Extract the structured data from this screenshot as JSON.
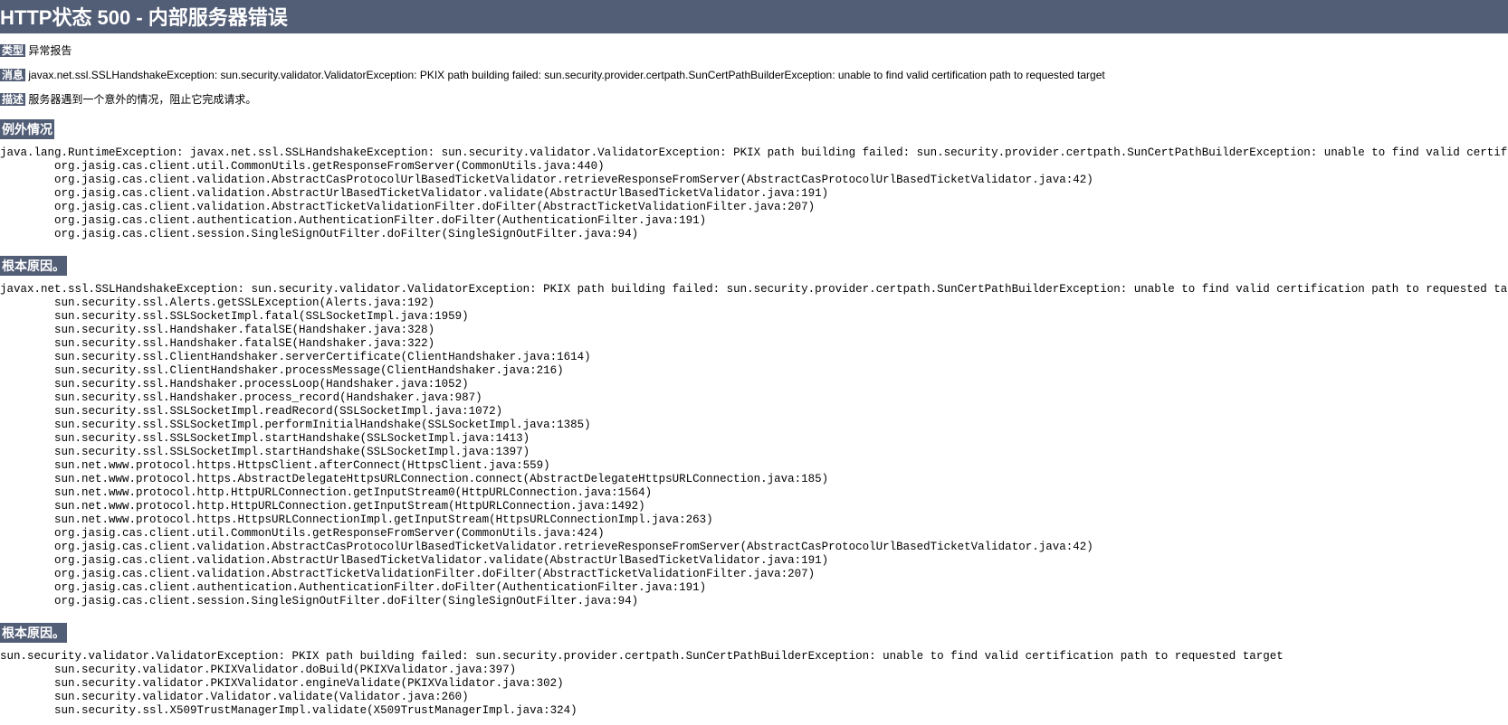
{
  "header": {
    "title": "HTTP状态 500 - 内部服务器错误"
  },
  "labels": {
    "type": "类型",
    "message": "消息",
    "description": "描述",
    "exception": "例外情况",
    "rootCause": "根本原因。"
  },
  "values": {
    "type": "异常报告",
    "message": "javax.net.ssl.SSLHandshakeException: sun.security.validator.ValidatorException: PKIX path building failed: sun.security.provider.certpath.SunCertPathBuilderException: unable to find valid certification path to requested target",
    "description": "服务器遇到一个意外的情况，阻止它完成请求。"
  },
  "stacks": {
    "exception": "java.lang.RuntimeException: javax.net.ssl.SSLHandshakeException: sun.security.validator.ValidatorException: PKIX path building failed: sun.security.provider.certpath.SunCertPathBuilderException: unable to find valid certification path to r\n\torg.jasig.cas.client.util.CommonUtils.getResponseFromServer(CommonUtils.java:440)\n\torg.jasig.cas.client.validation.AbstractCasProtocolUrlBasedTicketValidator.retrieveResponseFromServer(AbstractCasProtocolUrlBasedTicketValidator.java:42)\n\torg.jasig.cas.client.validation.AbstractUrlBasedTicketValidator.validate(AbstractUrlBasedTicketValidator.java:191)\n\torg.jasig.cas.client.validation.AbstractTicketValidationFilter.doFilter(AbstractTicketValidationFilter.java:207)\n\torg.jasig.cas.client.authentication.AuthenticationFilter.doFilter(AuthenticationFilter.java:191)\n\torg.jasig.cas.client.session.SingleSignOutFilter.doFilter(SingleSignOutFilter.java:94)",
    "rootCause1": "javax.net.ssl.SSLHandshakeException: sun.security.validator.ValidatorException: PKIX path building failed: sun.security.provider.certpath.SunCertPathBuilderException: unable to find valid certification path to requested target\n\tsun.security.ssl.Alerts.getSSLException(Alerts.java:192)\n\tsun.security.ssl.SSLSocketImpl.fatal(SSLSocketImpl.java:1959)\n\tsun.security.ssl.Handshaker.fatalSE(Handshaker.java:328)\n\tsun.security.ssl.Handshaker.fatalSE(Handshaker.java:322)\n\tsun.security.ssl.ClientHandshaker.serverCertificate(ClientHandshaker.java:1614)\n\tsun.security.ssl.ClientHandshaker.processMessage(ClientHandshaker.java:216)\n\tsun.security.ssl.Handshaker.processLoop(Handshaker.java:1052)\n\tsun.security.ssl.Handshaker.process_record(Handshaker.java:987)\n\tsun.security.ssl.SSLSocketImpl.readRecord(SSLSocketImpl.java:1072)\n\tsun.security.ssl.SSLSocketImpl.performInitialHandshake(SSLSocketImpl.java:1385)\n\tsun.security.ssl.SSLSocketImpl.startHandshake(SSLSocketImpl.java:1413)\n\tsun.security.ssl.SSLSocketImpl.startHandshake(SSLSocketImpl.java:1397)\n\tsun.net.www.protocol.https.HttpsClient.afterConnect(HttpsClient.java:559)\n\tsun.net.www.protocol.https.AbstractDelegateHttpsURLConnection.connect(AbstractDelegateHttpsURLConnection.java:185)\n\tsun.net.www.protocol.http.HttpURLConnection.getInputStream0(HttpURLConnection.java:1564)\n\tsun.net.www.protocol.http.HttpURLConnection.getInputStream(HttpURLConnection.java:1492)\n\tsun.net.www.protocol.https.HttpsURLConnectionImpl.getInputStream(HttpsURLConnectionImpl.java:263)\n\torg.jasig.cas.client.util.CommonUtils.getResponseFromServer(CommonUtils.java:424)\n\torg.jasig.cas.client.validation.AbstractCasProtocolUrlBasedTicketValidator.retrieveResponseFromServer(AbstractCasProtocolUrlBasedTicketValidator.java:42)\n\torg.jasig.cas.client.validation.AbstractUrlBasedTicketValidator.validate(AbstractUrlBasedTicketValidator.java:191)\n\torg.jasig.cas.client.validation.AbstractTicketValidationFilter.doFilter(AbstractTicketValidationFilter.java:207)\n\torg.jasig.cas.client.authentication.AuthenticationFilter.doFilter(AuthenticationFilter.java:191)\n\torg.jasig.cas.client.session.SingleSignOutFilter.doFilter(SingleSignOutFilter.java:94)",
    "rootCause2": "sun.security.validator.ValidatorException: PKIX path building failed: sun.security.provider.certpath.SunCertPathBuilderException: unable to find valid certification path to requested target\n\tsun.security.validator.PKIXValidator.doBuild(PKIXValidator.java:397)\n\tsun.security.validator.PKIXValidator.engineValidate(PKIXValidator.java:302)\n\tsun.security.validator.Validator.validate(Validator.java:260)\n\tsun.security.ssl.X509TrustManagerImpl.validate(X509TrustManagerImpl.java:324)"
  }
}
